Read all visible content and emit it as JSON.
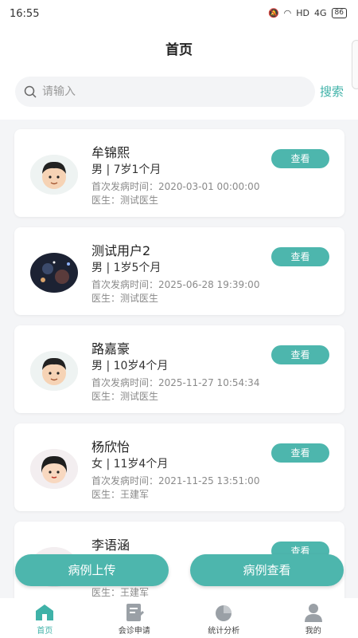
{
  "status": {
    "time": "16:55",
    "network": "HD",
    "signal": "4G",
    "battery": "86"
  },
  "header": {
    "title": "首页"
  },
  "search": {
    "placeholder": "请输入",
    "button_label": "搜索"
  },
  "patients": [
    {
      "name": "牟锦熙",
      "gender_age": "男 | 7岁1个月",
      "onset": "首次发病时间：2020-03-01 00:00:00",
      "doctor": "医生：测试医生",
      "avatar": "boy-icon"
    },
    {
      "name": "测试用户2",
      "gender_age": "男 | 1岁5个月",
      "onset": "首次发病时间：2025-06-28 19:39:00",
      "doctor": "医生：测试医生",
      "avatar": "photo-icon"
    },
    {
      "name": "路嘉豪",
      "gender_age": "男 | 10岁4个月",
      "onset": "首次发病时间：2025-11-27 10:54:34",
      "doctor": "医生：测试医生",
      "avatar": "boy-icon"
    },
    {
      "name": "杨欣怡",
      "gender_age": "女 | 11岁4个月",
      "onset": "首次发病时间：2021-11-25 13:51:00",
      "doctor": "医生：王建军",
      "avatar": "girl-icon"
    },
    {
      "name": "李语涵",
      "gender_age": "",
      "onset": "",
      "doctor": "医生：王建军",
      "avatar": "girl-icon"
    }
  ],
  "view_label": "查看",
  "actions": {
    "upload_label": "病例上传",
    "view_cases_label": "病例查看"
  },
  "tabs": [
    {
      "label": "首页",
      "icon": "home-icon",
      "active": true
    },
    {
      "label": "会诊申请",
      "icon": "consult-icon",
      "active": false
    },
    {
      "label": "统计分析",
      "icon": "pie-chart-icon",
      "active": false
    },
    {
      "label": "我的",
      "icon": "user-icon",
      "active": false
    }
  ],
  "colors": {
    "accent": "#4db6ad",
    "accent_text": "#3fb2a8"
  }
}
